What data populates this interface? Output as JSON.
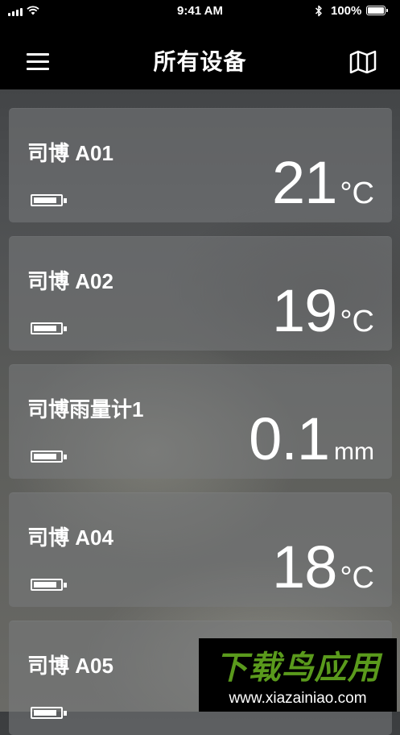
{
  "status_bar": {
    "time": "9:41 AM",
    "battery_percent": "100%",
    "icons": [
      "signal-icon",
      "wifi-icon",
      "bluetooth-icon",
      "battery-icon"
    ]
  },
  "nav": {
    "title": "所有设备",
    "left_icon": "menu-icon",
    "right_icon": "map-icon"
  },
  "devices": [
    {
      "name": "司博 A01",
      "value": "21",
      "unit": "°C",
      "battery_icon": "battery-icon"
    },
    {
      "name": "司博 A02",
      "value": "19",
      "unit": "°C",
      "battery_icon": "battery-icon"
    },
    {
      "name": "司博雨量计1",
      "value": "0.1",
      "unit": "mm",
      "battery_icon": "battery-icon"
    },
    {
      "name": "司博 A04",
      "value": "18",
      "unit": "°C",
      "battery_icon": "battery-icon"
    },
    {
      "name": "司博 A05",
      "value": "",
      "unit": "",
      "battery_icon": "battery-icon"
    }
  ],
  "watermark": {
    "title": "下载鸟应用",
    "url": "www.xiazainiao.com"
  },
  "colors": {
    "bar_background": "#000000",
    "text": "#ffffff",
    "watermark_green": "#5a9a1c"
  }
}
